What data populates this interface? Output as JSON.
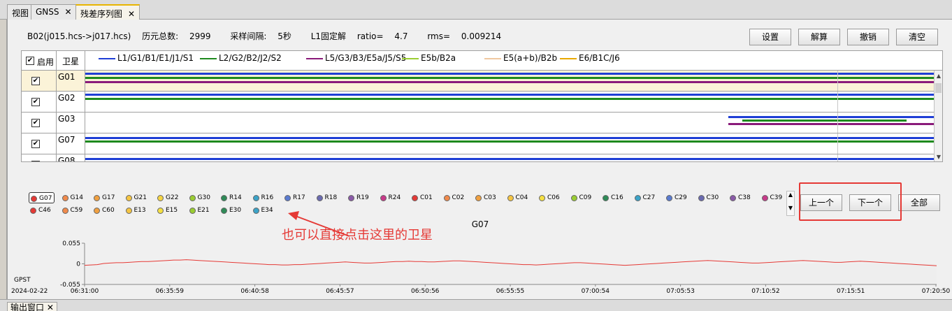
{
  "tabs": [
    {
      "label": "视图",
      "closable": false
    },
    {
      "label": "GNSS",
      "closable": true
    },
    {
      "label": "残差序列图",
      "closable": true,
      "active": true
    }
  ],
  "info": {
    "baseline": "B02(j015.hcs->j017.hcs)",
    "epochs_label": "历元总数:",
    "epochs_value": "2999",
    "interval_label": "采样间隔:",
    "interval_value": "5秒",
    "solution": "L1固定解",
    "ratio_label": "ratio=",
    "ratio_value": "4.7",
    "rms_label": "rms=",
    "rms_value": "0.009214"
  },
  "toolbar": {
    "settings": "设置",
    "solve": "解算",
    "undo": "撤销",
    "clear": "清空"
  },
  "grid": {
    "enable_header": "启用",
    "sat_header": "卫星",
    "legend": [
      {
        "label": "L1/G1/B1/E1/J1/S1",
        "color": "#1f3fd6"
      },
      {
        "label": "L2/G2/B2/J2/S2",
        "color": "#1e8a1e"
      },
      {
        "label": "L5/G3/B3/E5a/J5/S5",
        "color": "#8a1a7a"
      },
      {
        "label": "E5b/B2a",
        "color": "#9acd32"
      },
      {
        "label": "E5(a+b)/B2b",
        "color": "#f0c8a0"
      },
      {
        "label": "E6/B1C/J6",
        "color": "#e8a800"
      }
    ],
    "rows": [
      {
        "sat": "G01",
        "checked": true,
        "highlight": true
      },
      {
        "sat": "G02",
        "checked": true,
        "highlight": false
      },
      {
        "sat": "G03",
        "checked": true,
        "highlight": false
      },
      {
        "sat": "G07",
        "checked": true,
        "highlight": false
      },
      {
        "sat": "G08",
        "checked": true,
        "highlight": false
      }
    ]
  },
  "satellites": [
    {
      "id": "G07",
      "color": "#e53935",
      "selected": true
    },
    {
      "id": "G14",
      "color": "#f08a4b"
    },
    {
      "id": "G17",
      "color": "#f0a040"
    },
    {
      "id": "G21",
      "color": "#f5c542"
    },
    {
      "id": "G22",
      "color": "#f5d442"
    },
    {
      "id": "G30",
      "color": "#9acd32"
    },
    {
      "id": "R14",
      "color": "#2e8b57"
    },
    {
      "id": "R16",
      "color": "#3ba3c8"
    },
    {
      "id": "R17",
      "color": "#5a7bd0"
    },
    {
      "id": "R18",
      "color": "#6a6ab0"
    },
    {
      "id": "R19",
      "color": "#8a5aa8"
    },
    {
      "id": "R24",
      "color": "#c83a8a"
    },
    {
      "id": "C01",
      "color": "#e53935"
    },
    {
      "id": "C02",
      "color": "#f08a4b"
    },
    {
      "id": "C03",
      "color": "#f0a040"
    },
    {
      "id": "C04",
      "color": "#f5c542"
    },
    {
      "id": "C06",
      "color": "#f5e042"
    },
    {
      "id": "C09",
      "color": "#9acd32"
    },
    {
      "id": "C16",
      "color": "#2e8b57"
    },
    {
      "id": "C27",
      "color": "#3ba3c8"
    },
    {
      "id": "C29",
      "color": "#5a7bd0"
    },
    {
      "id": "C30",
      "color": "#6a6ab0"
    },
    {
      "id": "C38",
      "color": "#8a5aa8"
    },
    {
      "id": "C39",
      "color": "#c83a8a"
    },
    {
      "id": "C46",
      "color": "#e53935"
    },
    {
      "id": "C59",
      "color": "#f08a4b"
    },
    {
      "id": "C60",
      "color": "#f0a040"
    },
    {
      "id": "E13",
      "color": "#f5c542"
    },
    {
      "id": "E15",
      "color": "#f5e042"
    },
    {
      "id": "E21",
      "color": "#9acd32"
    },
    {
      "id": "E30",
      "color": "#2e8b57"
    },
    {
      "id": "E34",
      "color": "#3ba3c8"
    }
  ],
  "nav": {
    "prev": "上一个",
    "next": "下一个",
    "all": "全部"
  },
  "annotation": "也可以直接点击这里的卫星",
  "chart_data": {
    "type": "line",
    "title": "G07",
    "xlabel": "GPST",
    "date": "2024-02-22",
    "x_ticks": [
      "06:31:00",
      "06:35:59",
      "06:40:58",
      "06:45:57",
      "06:50:56",
      "06:55:55",
      "07:00:54",
      "07:05:53",
      "07:10:52",
      "07:15:51",
      "07:20:50"
    ],
    "ylim": [
      -0.055,
      0.055
    ],
    "y_ticks": [
      "0.055",
      "0",
      "-0.055"
    ],
    "series": [
      {
        "color": "#e53935",
        "values": [
          -0.004,
          -0.003,
          -0.002,
          0.001,
          0.002,
          0.003,
          0.003,
          0.004,
          0.005,
          0.006,
          0.006,
          0.007,
          0.008,
          0.009,
          0.01,
          0.01,
          0.011,
          0.01,
          0.009,
          0.008,
          0.007,
          0.006,
          0.005,
          0.004,
          0.003,
          0.002,
          0.001,
          0.0,
          -0.001,
          -0.002,
          -0.002,
          -0.003,
          -0.003,
          -0.002,
          -0.002,
          -0.001,
          0.0,
          0.001,
          0.002,
          0.003,
          0.004,
          0.005,
          0.004,
          0.003,
          0.002,
          0.002,
          0.003,
          0.004,
          0.005,
          0.006,
          0.006,
          0.007,
          0.006,
          0.006,
          0.005,
          0.005,
          0.006,
          0.007,
          0.008,
          0.008,
          0.007,
          0.006,
          0.005,
          0.004,
          0.003,
          0.002,
          0.001,
          0.0,
          -0.001,
          -0.002,
          -0.002,
          -0.003,
          -0.002,
          -0.001,
          0.0,
          0.001,
          0.002,
          0.003,
          0.003,
          0.002,
          0.001,
          0.0,
          -0.001,
          -0.002,
          -0.003,
          -0.004,
          -0.003,
          -0.002,
          -0.001,
          0.0,
          0.001,
          0.002,
          0.003,
          0.004,
          0.005,
          0.006,
          0.007,
          0.008,
          0.009,
          0.008,
          0.007,
          0.006,
          0.005,
          0.004,
          0.003,
          0.002,
          0.002,
          0.003,
          0.004,
          0.005,
          0.006,
          0.007,
          0.008,
          0.009,
          0.008,
          0.007,
          0.006,
          0.005,
          0.004,
          0.004,
          0.005,
          0.006,
          0.007,
          0.006,
          0.005,
          0.004,
          0.003,
          0.002,
          0.001,
          0.0,
          -0.001,
          -0.002,
          -0.003,
          -0.004,
          -0.005
        ]
      }
    ],
    "grid": false
  },
  "bottom_tab": "输出窗口"
}
